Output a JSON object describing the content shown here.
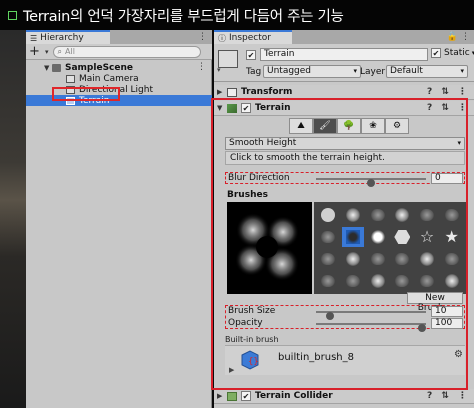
{
  "banner": {
    "title": "Terrain의 언덕 가장자리를 부드럽게 다듬어 주는 기능"
  },
  "hierarchy": {
    "tab_label": "Hierarchy",
    "tab_menu": "⋮",
    "add_label": "+",
    "add_caret": "▾",
    "search_placeholder": "All",
    "scene_name": "SampleScene",
    "scene_menu": "⋮",
    "items": [
      {
        "label": "Main Camera"
      },
      {
        "label": "Directional Light"
      },
      {
        "label": "Terrain"
      }
    ]
  },
  "inspector": {
    "tab_label": "Inspector",
    "tab_menu": "🔒 ⋮",
    "object_name": "Terrain",
    "active_checked": "✔",
    "static_label": "Static",
    "static_caret": "▾",
    "tag_label": "Tag",
    "tag_value": "Untagged",
    "layer_label": "Layer",
    "layer_value": "Default",
    "dd_caret": "▾",
    "components": {
      "transform": "Transform",
      "terrain": "Terrain",
      "terrain_collider": "Terrain Collider",
      "icons": "? ⇅ ⋮"
    },
    "tools": [
      {
        "glyph": "⛰"
      },
      {
        "glyph": "🖌"
      },
      {
        "glyph": "🌳"
      },
      {
        "glyph": "❀"
      },
      {
        "glyph": "⚙"
      }
    ],
    "paint_mode": "Smooth Height",
    "hint": "Click to smooth the terrain height.",
    "blur_direction": {
      "label": "Blur Direction",
      "value": "0",
      "level": 0.5
    },
    "brushes_label": "Brushes",
    "new_brush_label": "New Brush...",
    "brush_size": {
      "label": "Brush Size",
      "value": "10",
      "level": 0.1
    },
    "opacity": {
      "label": "Opacity",
      "value": "100",
      "level": 1.0
    },
    "builtin_label": "Built-in brush",
    "brush_asset_name": "builtin_brush_8",
    "fold_open": "▼",
    "fold_closed": "▶",
    "gear": "⚙",
    "check": "✔"
  },
  "colors": {
    "selection": "#3a79d7",
    "highlight": "#d8202a",
    "banner_box": "#5fd35f"
  }
}
